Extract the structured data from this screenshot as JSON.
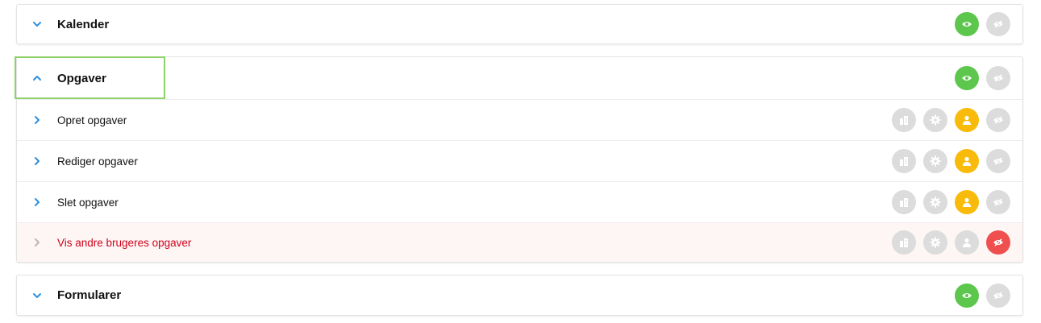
{
  "sections": [
    {
      "title": "Kalender",
      "expanded": false,
      "visible_state": "visible"
    },
    {
      "title": "Opgaver",
      "expanded": true,
      "visible_state": "visible",
      "items": [
        {
          "label": "Opret opgaver",
          "permission": "user",
          "denied": false
        },
        {
          "label": "Rediger opgaver",
          "permission": "user",
          "denied": false
        },
        {
          "label": "Slet opgaver",
          "permission": "user",
          "denied": false
        },
        {
          "label": "Vis andre brugeres opgaver",
          "permission": "hidden",
          "denied": true
        }
      ]
    },
    {
      "title": "Formularer",
      "expanded": false,
      "visible_state": "visible"
    }
  ],
  "colors": {
    "accent_blue": "#2d8fe0",
    "visible_green": "#5cc74c",
    "user_yellow": "#f8bb0b",
    "hidden_red": "#f04f4f",
    "inactive_grey": "#dcdcdc",
    "denied_text": "#d0021b",
    "focus_outline": "#8fd16a"
  },
  "icons": {
    "collapsed": "chevron-down-icon",
    "expanded": "chevron-up-icon",
    "item": "chevron-right-icon",
    "visible": "eye-icon",
    "hidden": "eye-slash-icon",
    "company": "building-icon",
    "settings": "gear-icon",
    "user": "user-icon"
  }
}
